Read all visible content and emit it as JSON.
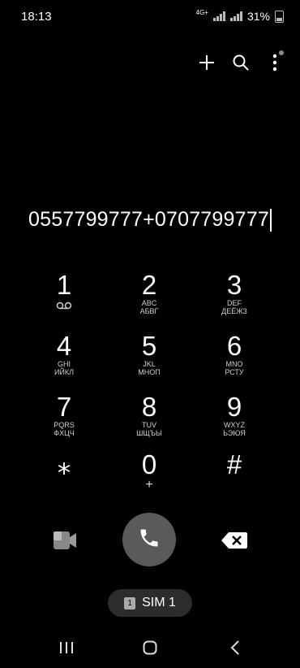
{
  "status": {
    "time": "18:13",
    "network": "4G+",
    "battery": "31%"
  },
  "dial": {
    "number": "0557799777+0707799777"
  },
  "keys": [
    {
      "digit": "1",
      "sub": "",
      "sub2": ""
    },
    {
      "digit": "2",
      "sub": "ABC",
      "sub2": "АБВГ"
    },
    {
      "digit": "3",
      "sub": "DEF",
      "sub2": "ДЕЁЖЗ"
    },
    {
      "digit": "4",
      "sub": "GHI",
      "sub2": "ИЙКЛ"
    },
    {
      "digit": "5",
      "sub": "JKL",
      "sub2": "МНОП"
    },
    {
      "digit": "6",
      "sub": "MNO",
      "sub2": "РСТУ"
    },
    {
      "digit": "7",
      "sub": "PQRS",
      "sub2": "ФХЦЧ"
    },
    {
      "digit": "8",
      "sub": "TUV",
      "sub2": "ШЩЪЫ"
    },
    {
      "digit": "9",
      "sub": "WXYZ",
      "sub2": "ЬЭЮЯ"
    },
    {
      "digit": "⁎",
      "sub": "",
      "sub2": ""
    },
    {
      "digit": "0",
      "sub": "+",
      "sub2": ""
    },
    {
      "digit": "#",
      "sub": "",
      "sub2": ""
    }
  ],
  "sim": {
    "number": "1",
    "label": "SIM 1"
  },
  "icons": {
    "add": "plus-icon",
    "search": "search-icon",
    "more": "more-vert-icon",
    "call": "phone-icon",
    "video": "video-call-icon",
    "delete": "backspace-icon",
    "voicemail": "voicemail-icon"
  }
}
